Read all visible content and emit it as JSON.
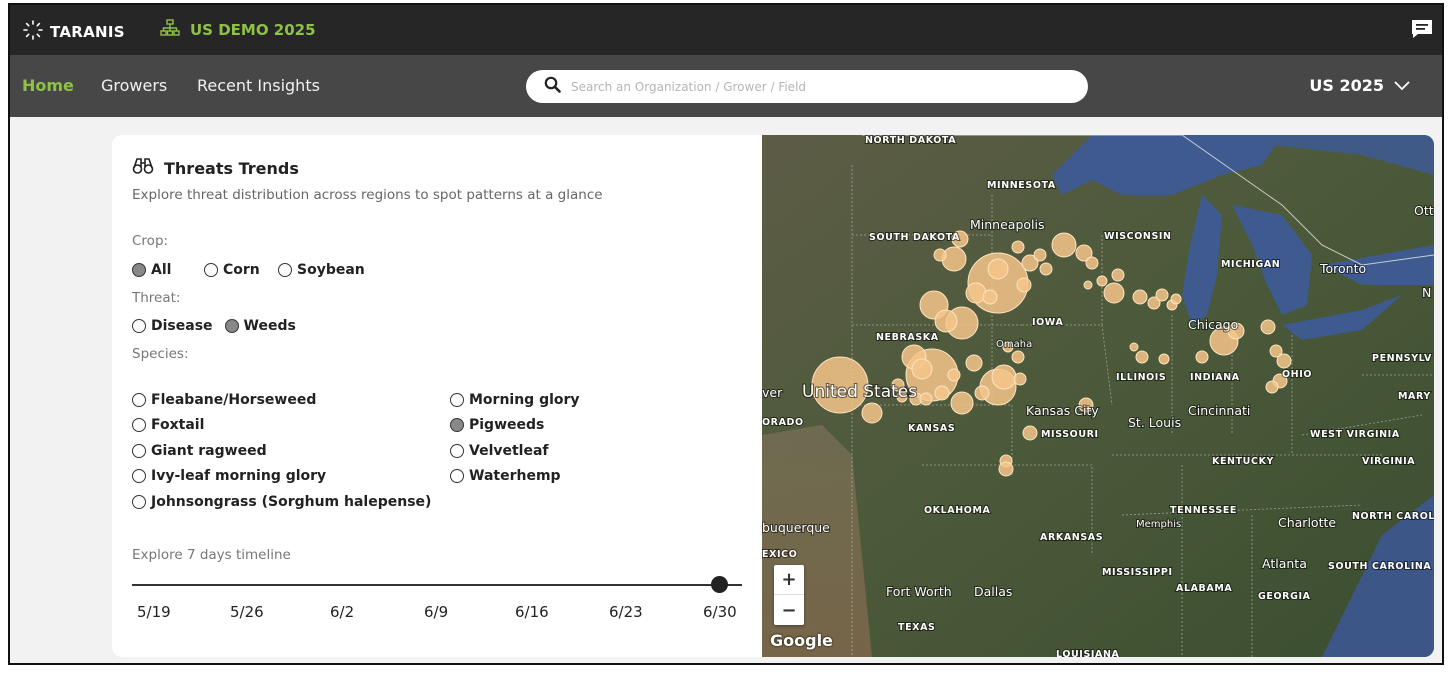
{
  "app": {
    "logo_text": "TARANIS",
    "org_name": "US DEMO 2025",
    "icons": {
      "logo": "sunburst-logo-icon",
      "org": "org-hierarchy-icon",
      "chat": "chat-icon",
      "search": "search-icon",
      "chevron": "chevron-down-icon",
      "binoculars": "binoculars-icon"
    },
    "accent_color": "#8fc146"
  },
  "nav": {
    "items": [
      {
        "label": "Home",
        "active": true
      },
      {
        "label": "Growers",
        "active": false
      },
      {
        "label": "Recent Insights",
        "active": false
      }
    ],
    "search_placeholder": "Search an Organization / Grower / Field",
    "season": "US 2025"
  },
  "panel": {
    "title": "Threats Trends",
    "subtitle": "Explore threat distribution across regions to spot patterns at a glance",
    "crop_label": "Crop:",
    "crops": [
      {
        "label": "All",
        "selected": true
      },
      {
        "label": "Corn",
        "selected": false
      },
      {
        "label": "Soybean",
        "selected": false
      }
    ],
    "threat_label": "Threat:",
    "threats": [
      {
        "label": "Disease",
        "selected": false
      },
      {
        "label": "Weeds",
        "selected": true
      }
    ],
    "species_label": "Species:",
    "species": [
      {
        "label": "Fleabane/Horseweed",
        "selected": false
      },
      {
        "label": "Foxtail",
        "selected": false
      },
      {
        "label": "Giant ragweed",
        "selected": false
      },
      {
        "label": "Ivy-leaf morning glory",
        "selected": false
      },
      {
        "label": "Johnsongrass (Sorghum halepense)",
        "selected": false
      },
      {
        "label": "Morning glory",
        "selected": false
      },
      {
        "label": "Pigweeds",
        "selected": true
      },
      {
        "label": "Velvetleaf",
        "selected": false
      },
      {
        "label": "Waterhemp",
        "selected": false
      }
    ],
    "timeline_label": "Explore 7 days timeline",
    "timeline_ticks": [
      "5/19",
      "5/26",
      "6/2",
      "6/9",
      "6/16",
      "6/23",
      "6/30"
    ],
    "timeline_selected": "6/30"
  },
  "map": {
    "attribution": "Google",
    "zoom_in": "+",
    "zoom_out": "−",
    "state_labels": [
      "NORTH DAKOTA",
      "MINNESOTA",
      "SOUTH DAKOTA",
      "WISCONSIN",
      "MICHIGAN",
      "IOWA",
      "NEBRASKA",
      "ILLINOIS",
      "INDIANA",
      "OHIO",
      "PENNSYLV",
      "KANSAS",
      "MISSOURI",
      "WEST VIRGINIA",
      "KENTUCKY",
      "VIRGINIA",
      "OKLAHOMA",
      "TENNESSEE",
      "NORTH CAROLINA",
      "ARKANSAS",
      "SOUTH CAROLINA",
      "MISSISSIPPI",
      "ALABAMA",
      "GEORGIA",
      "TEXAS",
      "LOUISIANA",
      "ORADO",
      "EXICO"
    ],
    "city_labels": [
      "Minneapolis",
      "Toronto",
      "Chicago",
      "Omaha",
      "Kansas City",
      "St. Louis",
      "Cincinnati",
      "Memphis",
      "Charlotte",
      "Atlanta",
      "Fort Worth",
      "Dallas",
      "buquerque",
      "Ott",
      "United States",
      "ver",
      "N",
      "MARY"
    ],
    "marker_color": "#f5c58a"
  }
}
